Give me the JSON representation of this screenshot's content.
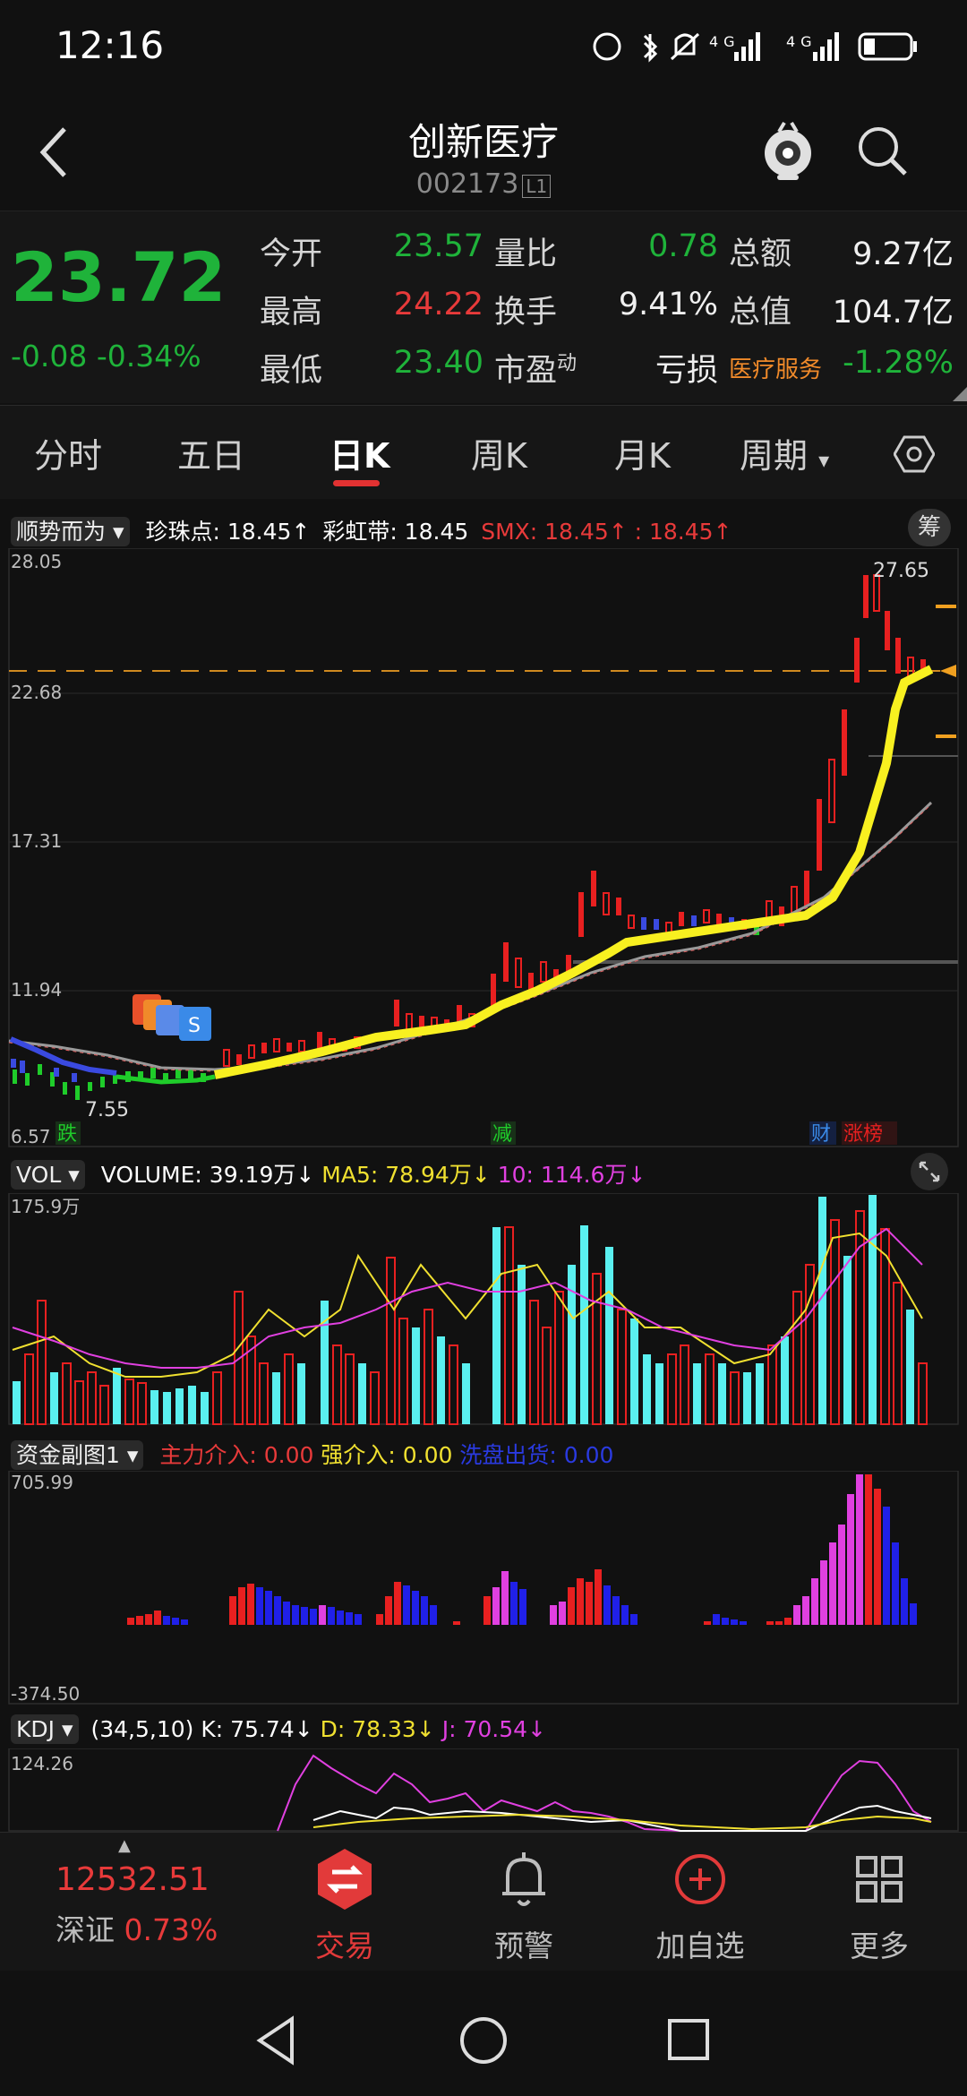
{
  "status_bar": {
    "time": "12:16",
    "network": "4G 4G"
  },
  "header": {
    "title": "创新医疗",
    "code": "002173",
    "level_tag": "L1"
  },
  "quote": {
    "price": "23.72",
    "change": "-0.08",
    "change_pct": "-0.34%",
    "rows": [
      [
        {
          "label": "今开",
          "value": "23.57",
          "color": "g"
        },
        {
          "label": "量比",
          "value": "0.78",
          "color": "g"
        },
        {
          "label": "总额",
          "value": "9.27亿",
          "color": "w"
        }
      ],
      [
        {
          "label": "最高",
          "value": "24.22",
          "color": "r"
        },
        {
          "label": "换手",
          "value": "9.41%",
          "color": "w"
        },
        {
          "label": "总值",
          "value": "104.7亿",
          "color": "w"
        }
      ],
      [
        {
          "label": "最低",
          "value": "23.40",
          "color": "g"
        },
        {
          "label": "市盈",
          "sup": "动",
          "value": "亏损",
          "color": "w"
        },
        {
          "label": "医疗服务",
          "value": "-1.28%",
          "color": "g"
        }
      ]
    ]
  },
  "tabs": [
    "分时",
    "五日",
    "日K",
    "周K",
    "月K",
    "周期"
  ],
  "main_indicator": {
    "selector": "顺势而为",
    "items": [
      {
        "text": "珍珠点: 18.45↑",
        "color": "#ffffff"
      },
      {
        "text": "彩虹带: 18.45",
        "color": "#ffffff"
      },
      {
        "text": "SMX: 18.45↑ : 18.45↑",
        "color": "#e83a3a"
      }
    ],
    "chip_label": "筹"
  },
  "price_axis": [
    "28.05",
    "22.68",
    "17.31",
    "11.94",
    "6.57"
  ],
  "kline_labels": {
    "high": "27.65",
    "low": "7.55",
    "tag_die": "跌",
    "tag_jian": "减",
    "tag_cai": "财",
    "tag_zhang": "涨榜",
    "signal": "S"
  },
  "volume_indicator": {
    "selector": "VOL",
    "items": [
      {
        "text": "VOLUME: 39.19万↓",
        "color": "#ffffff"
      },
      {
        "text": "MA5: 78.94万↓",
        "color": "#f0e030"
      },
      {
        "text": "10: 114.6万↓",
        "color": "#e040e0"
      }
    ],
    "axis_max": "175.9万"
  },
  "fund_indicator": {
    "selector": "资金副图1",
    "items": [
      {
        "text": "主力介入: 0.00",
        "color": "#e83a3a"
      },
      {
        "text": "强介入: 0.00",
        "color": "#f0e030"
      },
      {
        "text": "洗盘出货: 0.00",
        "color": "#2a3ae0"
      }
    ],
    "axis_max": "705.99",
    "axis_min": "-374.50"
  },
  "kdj_indicator": {
    "selector": "KDJ",
    "items": [
      {
        "text": "(34,5,10) K: 75.74↓",
        "color": "#ffffff"
      },
      {
        "text": "D: 78.33↓",
        "color": "#f0e030"
      },
      {
        "text": "J: 70.54↓",
        "color": "#e040e0"
      }
    ],
    "axis_max": "124.26"
  },
  "bottom_bar": {
    "index_value": "12532.51",
    "index_name": "深证",
    "index_pct": "0.73%",
    "items": [
      "交易",
      "预警",
      "加自选",
      "更多"
    ]
  }
}
